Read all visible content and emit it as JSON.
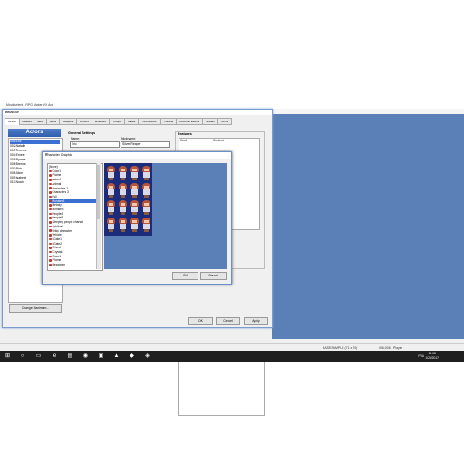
{
  "app": {
    "title": "Mockturtent - RPG Maker VX Ace",
    "status_left": "",
    "status_map": "BASESAMPLE (71 x 70)",
    "status_coords": "006,006",
    "status_mode": "Player"
  },
  "database": {
    "title": "Database",
    "tabs": [
      "Actors",
      "Classes",
      "Skills",
      "Items",
      "Weapons",
      "Armors",
      "Enemies",
      "Troops",
      "States",
      "Animations",
      "Tilesets",
      "Common Events",
      "System",
      "Terms"
    ],
    "actors_header": "Actors",
    "actors": [
      "001:Eric",
      "002:Natalie",
      "003:Terence",
      "004:Ernest",
      "005:Ryoma",
      "006:Brenda",
      "007:Rick",
      "008:Alice",
      "009:Isabelle",
      "010:Noah"
    ],
    "change_max_button": "Change Maximum...",
    "general_settings": "General Settings",
    "name_label": "Name:",
    "name_value": "Eric",
    "nickname_label": "Nickname:",
    "nickname_value": "Silver Reaper",
    "features_header": "Features",
    "features_col_kind": "Kind",
    "features_col_content": "Content",
    "ok": "OK",
    "cancel": "Cancel",
    "apply": "Apply"
  },
  "char_graphic": {
    "title": "Character Graphic",
    "files": [
      "(None)",
      "!Door1",
      "!Flame",
      "Actor4",
      "Animal",
      "characters 2",
      "Characters 3",
      "Evil",
      "Monster 1",
      "Melody",
      "Monster1",
      "People4",
      "People8",
      "Sleeping people charset",
      "Spiritual",
      "Uriko character",
      "Vehicle",
      "$Gate1",
      "$Gate2",
      "!Chest",
      "!Crystal",
      "!Door1",
      "!Flame",
      "Hexagram"
    ],
    "selected_index": 8,
    "ok": "OK",
    "cancel": "Cancel"
  },
  "taskbar": {
    "time": "19:08",
    "date": "1/20/2017",
    "lang": "FRA",
    "icons": [
      "windows-icon",
      "search-icon",
      "taskview-icon",
      "edge-icon",
      "explorer-icon",
      "chrome-icon",
      "store-icon",
      "rpgmaker-icon",
      "app-icon",
      "app2-icon"
    ]
  },
  "colors": {
    "accent": "#3b6fd1",
    "desktop": "#5b80b8",
    "sheet_bg": "#1c2b7a"
  }
}
